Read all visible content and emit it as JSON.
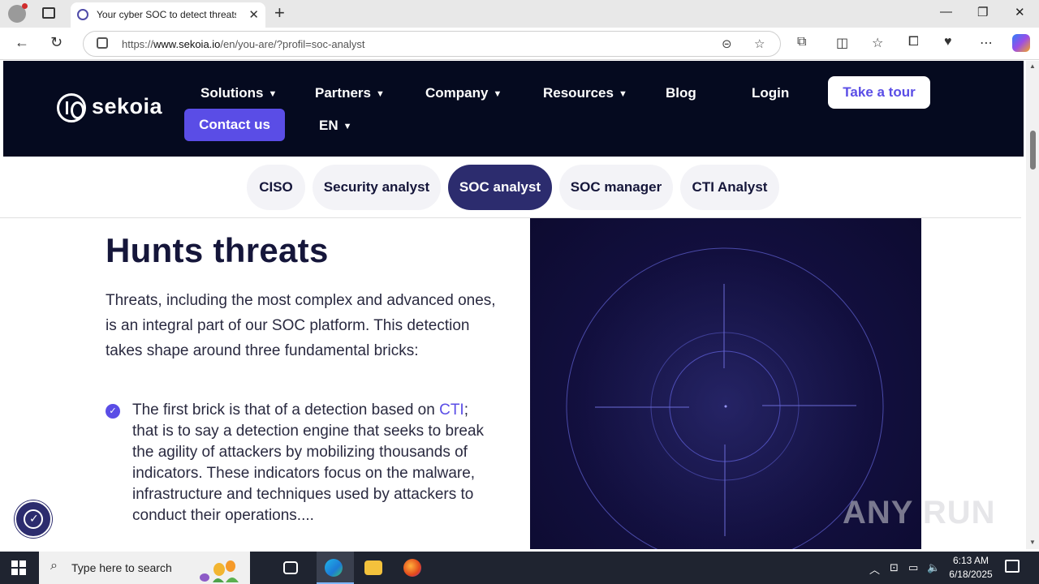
{
  "browser": {
    "tab_title": "Your cyber SOC to detect threats",
    "url_prefix": "https://",
    "url_domain": "www.sekoia.io",
    "url_path": "/en/you-are/?profil=soc-analyst"
  },
  "site": {
    "logo_text": "sekoia",
    "nav": {
      "solutions": "Solutions",
      "partners": "Partners",
      "company": "Company",
      "resources": "Resources",
      "blog": "Blog",
      "login": "Login",
      "take_tour": "Take a tour",
      "contact": "Contact us",
      "language": "EN"
    },
    "profile_tabs": [
      "CISO",
      "Security analyst",
      "SOC analyst",
      "SOC manager",
      "CTI Analyst"
    ],
    "active_profile": "SOC analyst",
    "heading": "Hunts threats",
    "intro": "Threats, including the most complex and advanced ones, is an integral part of our SOC platform. This detection takes shape around three fundamental bricks:",
    "bullet_prefix": "The first brick is that of a detection based on ",
    "bullet_link": "CTI",
    "bullet_rest": "; that is to say a detection engine that seeks to break the agility of attackers by mobilizing thousands of indicators. These indicators focus on the malware, infrastructure and techniques used by attackers to conduct their operations....",
    "accent_color": "#5a4de6",
    "dark_color": "#050a1f"
  },
  "watermark": "ANY RUN",
  "taskbar": {
    "search_placeholder": "Type here to search",
    "time": "6:13 AM",
    "date": "6/18/2025"
  }
}
